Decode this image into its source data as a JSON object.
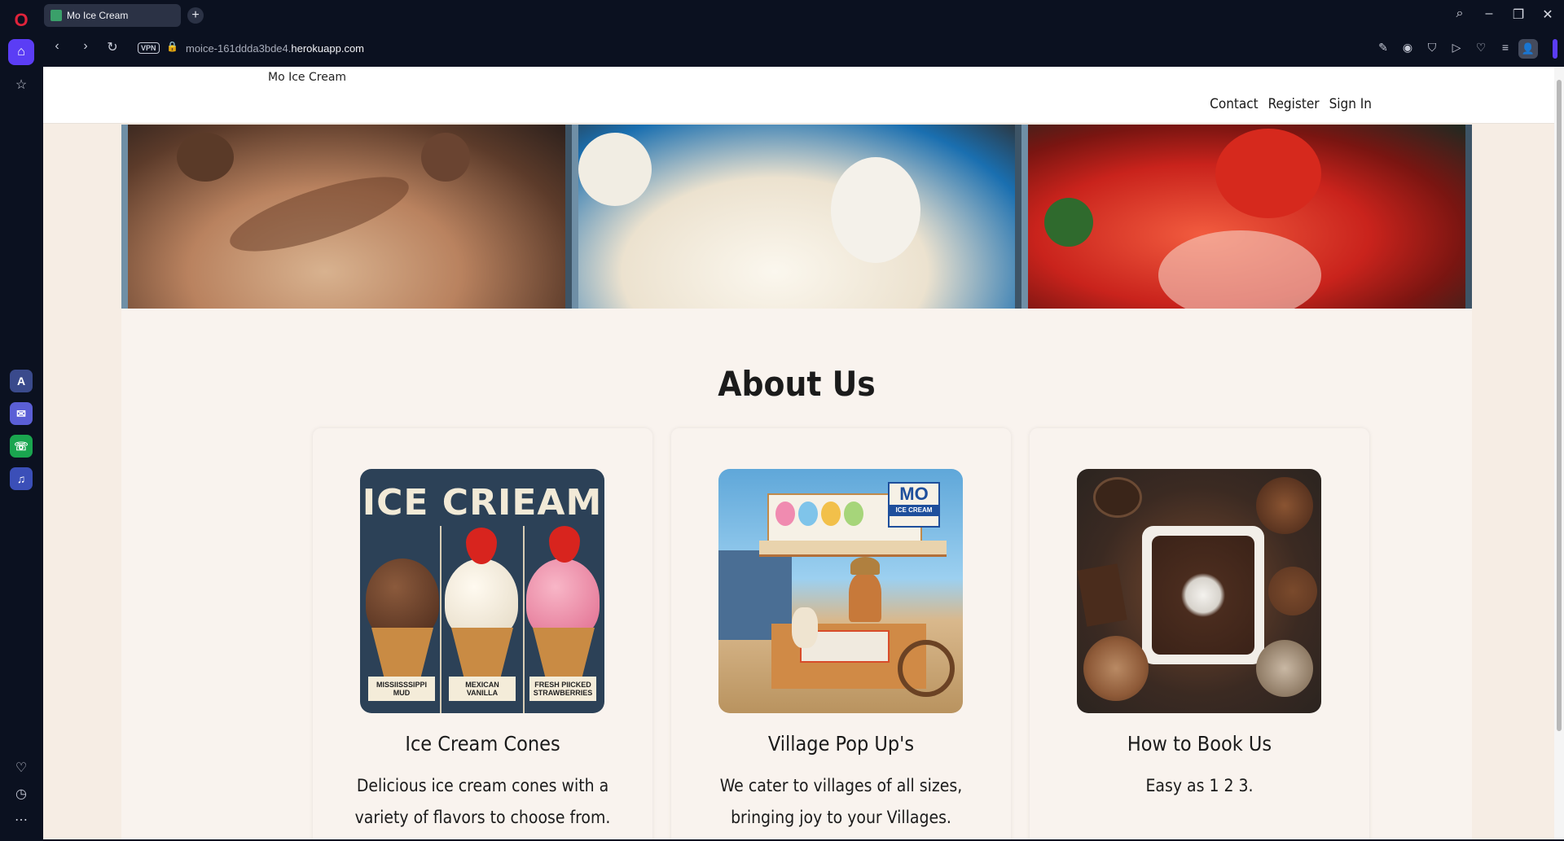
{
  "browser": {
    "tab_title": "Mo Ice Cream",
    "url_prefix": "moice-161ddda3bde4.",
    "url_domain": "herokuapp.com",
    "vpn_label": "VPN"
  },
  "site": {
    "brand": "Mo Ice Cream",
    "nav": [
      "Contact",
      "Register",
      "Sign In"
    ]
  },
  "about": {
    "title": "About Us",
    "cards": [
      {
        "title": "Ice Cream Cones",
        "text": "Delicious ice cream cones with a variety of flavors to choose from.",
        "image_text": {
          "heading": "ICE CRIEAM",
          "labels": [
            "MISSIISSSIPPI MUD",
            "MEXICAN VANILLA",
            "FRESH PIICKED STRAWBERRIES"
          ]
        }
      },
      {
        "title": "Village Pop Up's",
        "text": "We cater to villages of all sizes, bringing joy to your Villages.",
        "image_text": {
          "sign": "MO",
          "sign_sub": "ICE CREAM"
        }
      },
      {
        "title": "How to Book Us",
        "text": "Easy as 1 2 3."
      }
    ]
  }
}
